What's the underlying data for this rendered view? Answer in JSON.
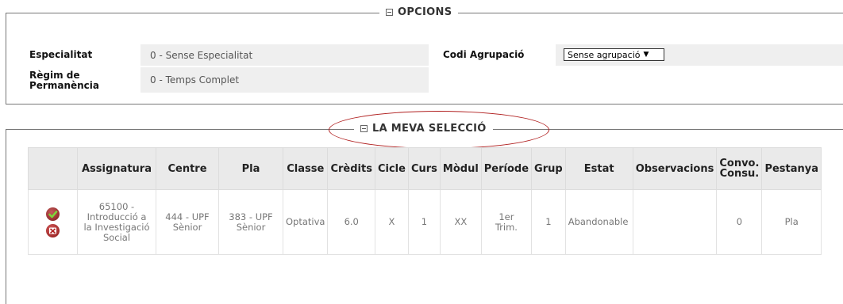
{
  "opcions": {
    "legend": "OPCIONS",
    "especialitat_label": "Especialitat",
    "especialitat_value": "0 - Sense Especialitat",
    "regim_label_1": "Règim de",
    "regim_label_2": "Permanència",
    "regim_value": "0 - Temps Complet",
    "agrupacio_label": "Codi Agrupació",
    "agrupacio_selected": "Sense agrupació"
  },
  "seleccio": {
    "legend": "LA MEVA SELECCIÓ",
    "headers": {
      "assignatura": "Assignatura",
      "centre": "Centre",
      "pla": "Pla",
      "classe": "Classe",
      "credits": "Crèdits",
      "cicle": "Cicle",
      "curs": "Curs",
      "modul": "Mòdul",
      "periode": "Període",
      "grup": "Grup",
      "estat": "Estat",
      "observacions": "Observacions",
      "convo_1": "Convo.",
      "convo_2": "Consu.",
      "pestanya": "Pestanya"
    },
    "rows": [
      {
        "assignatura_1": "65100 -",
        "assignatura_2": "Introducció a",
        "assignatura_3": "la Investigació",
        "assignatura_4": "Social",
        "centre_1": "444 - UPF",
        "centre_2": "Sènior",
        "pla_1": "383 - UPF",
        "pla_2": "Sènior",
        "classe": "Optativa",
        "credits": "6.0",
        "cicle": "X",
        "curs": "1",
        "modul": "XX",
        "periode_1": "1er",
        "periode_2": "Trim.",
        "grup": "1",
        "estat": "Abandonable",
        "observacions": "",
        "convo": "0",
        "pestanya": "Pla"
      }
    ]
  },
  "icons": {
    "confirm": "check-icon",
    "delete": "delete-icon"
  },
  "colors": {
    "highlight_ellipse": "#b01e1e",
    "header_bg": "#eaeaea",
    "value_bg": "#efefef"
  }
}
